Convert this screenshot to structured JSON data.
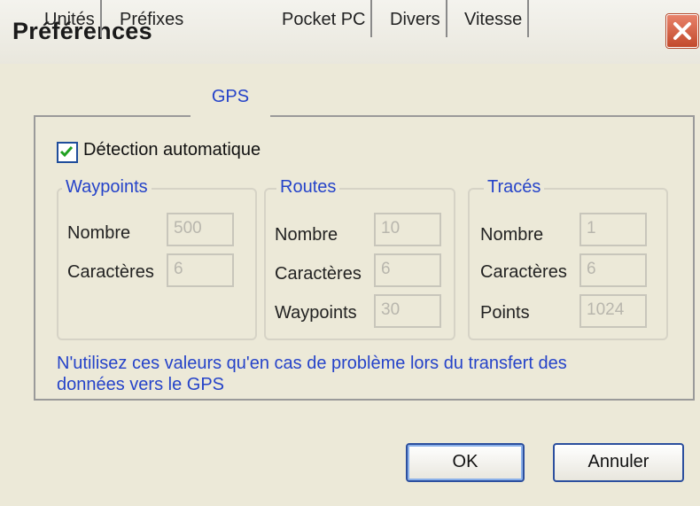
{
  "window": {
    "title": "Préférences"
  },
  "tabs": [
    "Unités",
    "Préfixes",
    "GPS",
    "Pocket PC",
    "Divers",
    "Vitesse"
  ],
  "active_tab": "GPS",
  "auto_detect": {
    "label": "Détection automatique",
    "checked": true
  },
  "groups": {
    "waypoints": {
      "title": "Waypoints",
      "rows": [
        {
          "label": "Nombre",
          "value": "500"
        },
        {
          "label": "Caractères",
          "value": "6"
        }
      ]
    },
    "routes": {
      "title": "Routes",
      "rows": [
        {
          "label": "Nombre",
          "value": "10"
        },
        {
          "label": "Caractères",
          "value": "6"
        },
        {
          "label": "Waypoints",
          "value": "30"
        }
      ]
    },
    "traces": {
      "title": "Tracés",
      "rows": [
        {
          "label": "Nombre",
          "value": "1"
        },
        {
          "label": "Caractères",
          "value": "6"
        },
        {
          "label": "Points",
          "value": "1024"
        }
      ]
    }
  },
  "note": "N'utilisez ces valeurs qu'en cas de problème lors du transfert des données vers le GPS",
  "buttons": {
    "ok": "OK",
    "cancel": "Annuler"
  },
  "colors": {
    "accent": "#2543c9",
    "close": "#c24a2c"
  },
  "icons": {
    "close": "close-icon",
    "check": "checkmark-icon"
  }
}
